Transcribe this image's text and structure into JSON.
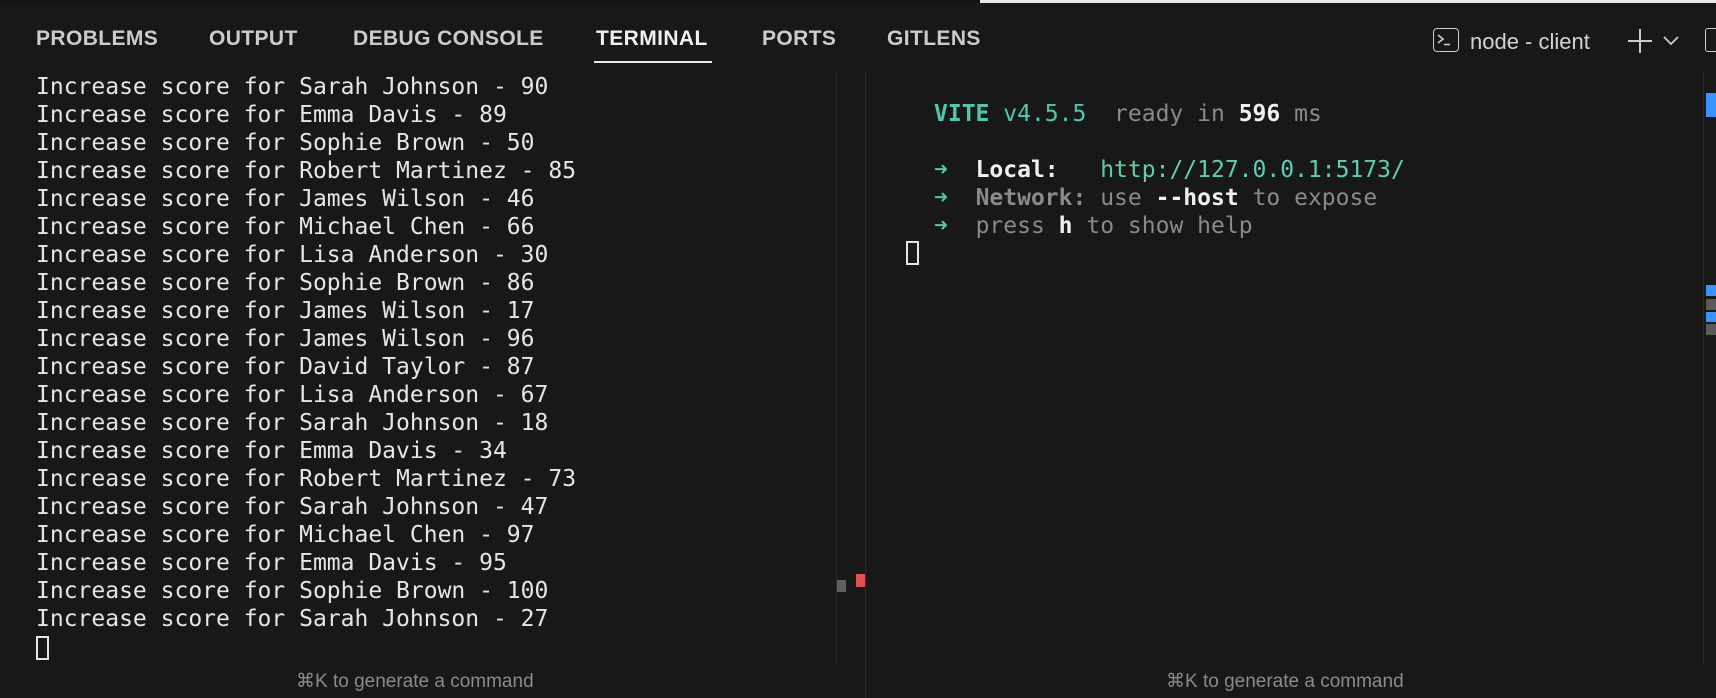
{
  "tabs": [
    {
      "label": "PROBLEMS",
      "active": false
    },
    {
      "label": "OUTPUT",
      "active": false
    },
    {
      "label": "DEBUG CONSOLE",
      "active": false
    },
    {
      "label": "TERMINAL",
      "active": true
    },
    {
      "label": "PORTS",
      "active": false
    },
    {
      "label": "GITLENS",
      "active": false
    }
  ],
  "terminal": {
    "name": "node - client"
  },
  "left_terminal": {
    "lines": [
      "Increase score for Sarah Johnson - 90",
      "Increase score for Emma Davis - 89",
      "Increase score for Sophie Brown - 50",
      "Increase score for Robert Martinez - 85",
      "Increase score for James Wilson - 46",
      "Increase score for Michael Chen - 66",
      "Increase score for Lisa Anderson - 30",
      "Increase score for Sophie Brown - 86",
      "Increase score for James Wilson - 17",
      "Increase score for James Wilson - 96",
      "Increase score for David Taylor - 87",
      "Increase score for Lisa Anderson - 67",
      "Increase score for Sarah Johnson - 18",
      "Increase score for Emma Davis - 34",
      "Increase score for Robert Martinez - 73",
      "Increase score for Sarah Johnson - 47",
      "Increase score for Michael Chen - 97",
      "Increase score for Emma Davis - 95",
      "Increase score for Sophie Brown - 100",
      "Increase score for Sarah Johnson - 27"
    ],
    "hint": "⌘K to generate a command"
  },
  "right_terminal": {
    "vite_name": "VITE",
    "vite_version": "v4.5.5",
    "ready_text": "ready in",
    "ready_ms": "596",
    "ms_unit": "ms",
    "arrow": "➜",
    "local_label": "Local:",
    "local_url": "http://127.0.0.1:5173/",
    "network_label": "Network:",
    "network_pre": "use",
    "network_flag": "--host",
    "network_post": "to expose",
    "help_pre": "press",
    "help_key": "h",
    "help_post": "to show help",
    "hint": "⌘K to generate a command"
  },
  "colors": {
    "background": "#181818",
    "accent_green": "#4ec9b0",
    "error_marker": "#e05252",
    "scroll_marker_blue": "#3794ff"
  }
}
